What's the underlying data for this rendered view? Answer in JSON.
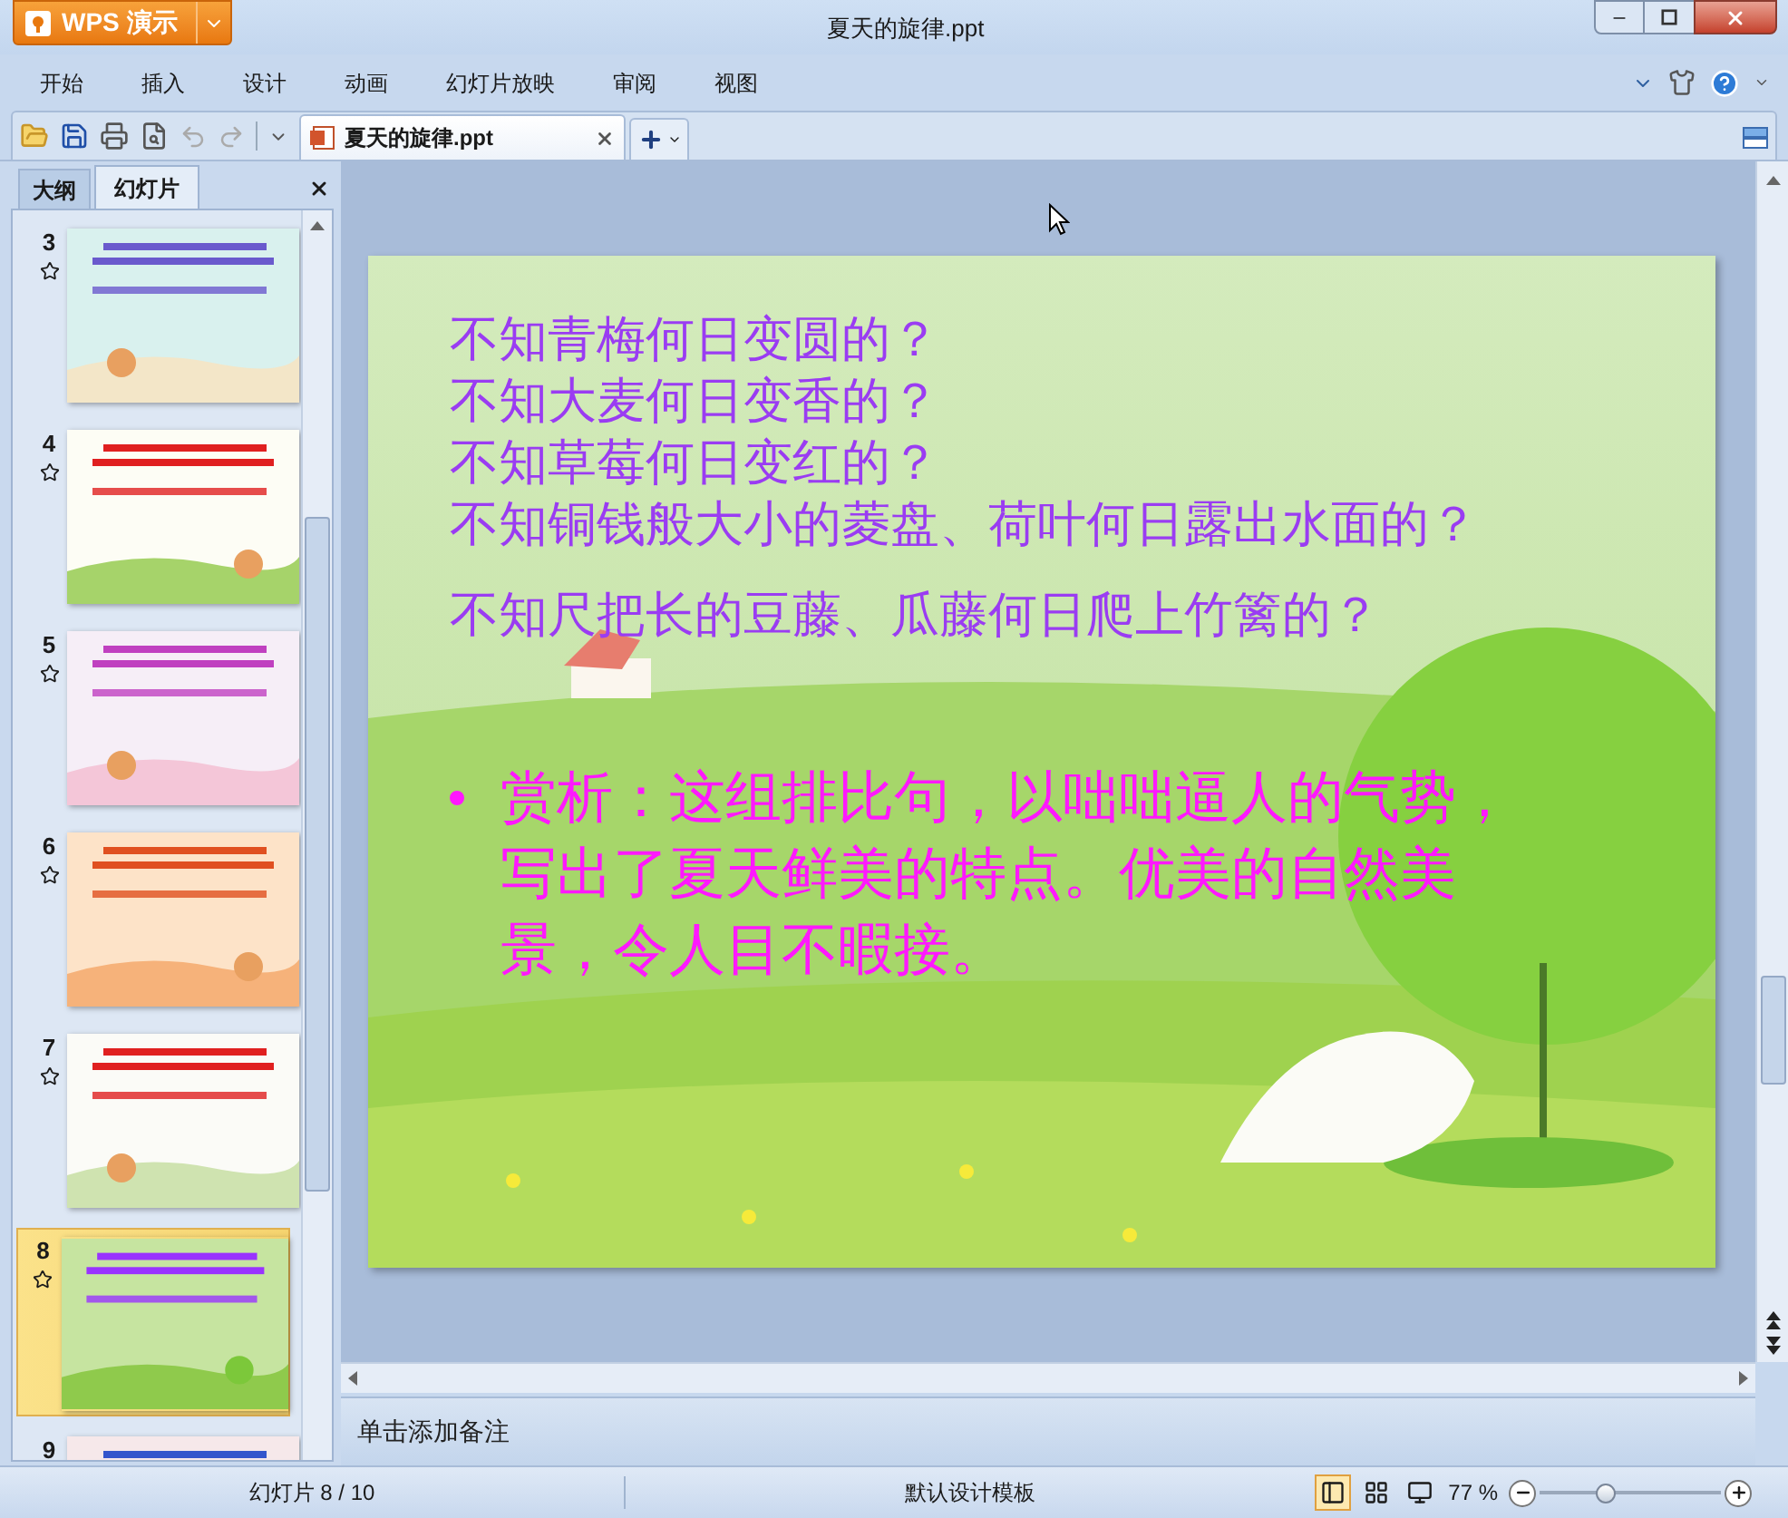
{
  "window": {
    "app_button": "WPS 演示",
    "title": "夏天的旋律.ppt"
  },
  "menu": [
    "开始",
    "插入",
    "设计",
    "动画",
    "幻灯片放映",
    "审阅",
    "视图"
  ],
  "document_tab": {
    "label": "夏天的旋律.ppt"
  },
  "panel_tabs": [
    {
      "label": "大纲",
      "selected": false
    },
    {
      "label": "幻灯片",
      "selected": true
    }
  ],
  "thumbnails": [
    {
      "number": "3",
      "selected": false,
      "kind": "picture"
    },
    {
      "number": "4",
      "selected": false,
      "kind": "picture"
    },
    {
      "number": "5",
      "selected": false,
      "kind": "picture"
    },
    {
      "number": "6",
      "selected": false,
      "kind": "picture"
    },
    {
      "number": "7",
      "selected": false,
      "kind": "picture"
    },
    {
      "number": "8",
      "selected": true,
      "kind": "picture"
    },
    {
      "number": "9",
      "selected": false,
      "kind": "picture"
    }
  ],
  "slide": {
    "questions": [
      "不知青梅何日变圆的？",
      "不知大麦何日变香的？",
      "不知草莓何日变红的？",
      "不知铜钱般大小的菱盘、荷叶何日露出水面的？",
      "不知尺把长的豆藤、瓜藤何日爬上竹篱的？"
    ],
    "bullet": "赏析：这组排比句，以咄咄逼人的气势，写出了夏天鲜美的特点。优美的自然美景，令人目不暇接。"
  },
  "notes": {
    "placeholder": "单击添加备注"
  },
  "status_bar": {
    "slide_count": "幻灯片 8 / 10",
    "template": "默认设计模板",
    "views": [
      {
        "kind": "normal",
        "selected": true
      },
      {
        "kind": "sorter",
        "selected": false
      },
      {
        "kind": "show",
        "selected": false
      }
    ],
    "zoom": "77 %",
    "zoom_level": {
      "level": 0.36
    }
  }
}
